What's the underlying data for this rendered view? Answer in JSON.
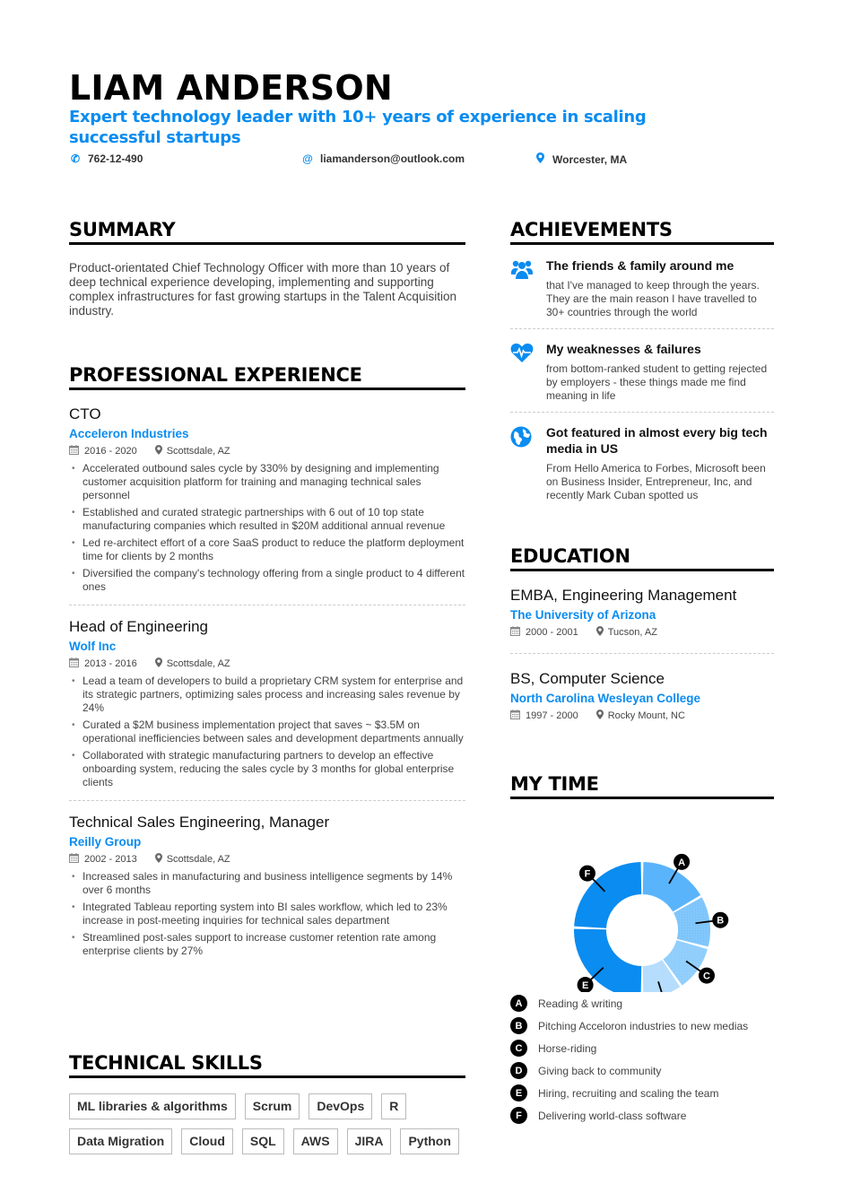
{
  "header": {
    "name": "LIAM ANDERSON",
    "tagline": "Expert technology leader with 10+ years of experience in scaling successful startups",
    "phone": "762-12-490",
    "email": "liamanderson@outlook.com",
    "location": "Worcester, MA",
    "icons": {
      "phone": "phone-icon",
      "email": "at-icon",
      "location": "map-pin-icon"
    }
  },
  "summary": {
    "title": "SUMMARY",
    "text": "Product-orientated Chief Technology Officer with more than 10 years of deep technical experience developing, implementing and supporting complex infrastructures for fast growing startups in the Talent Acquisition industry."
  },
  "experience": {
    "title": "PROFESSIONAL EXPERIENCE",
    "jobs": [
      {
        "title": "CTO",
        "company": "Acceleron Industries",
        "dates": "2016 - 2020",
        "location": "Scottsdale, AZ",
        "bullets": [
          "Accelerated outbound sales cycle by 330% by designing and implementing customer acquisition platform for training and managing technical sales personnel",
          "Established and curated strategic partnerships with 6 out of 10 top state manufacturing companies which resulted in $20M additional annual revenue",
          "Led re-architect effort of a core SaaS product to reduce the platform deployment time for clients by 2 months",
          "Diversified the company's technology offering from a single product to 4 different ones"
        ]
      },
      {
        "title": "Head of Engineering",
        "company": "Wolf Inc",
        "dates": "2013 - 2016",
        "location": "Scottsdale, AZ",
        "bullets": [
          "Lead a team of developers to build a proprietary CRM system for enterprise and its strategic partners, optimizing sales process and increasing sales revenue by 24%",
          "Curated a $2M business implementation project that saves ~ $3.5M on operational inefficiencies between sales and development departments annually",
          "Collaborated with strategic manufacturing partners to develop an effective onboarding system, reducing the sales cycle by 3 months for global enterprise clients"
        ]
      },
      {
        "title": "Technical Sales Engineering, Manager",
        "company": "Reilly Group",
        "dates": "2002 - 2013",
        "location": "Scottsdale, AZ",
        "bullets": [
          "Increased sales in manufacturing and business intelligence segments by 14% over 6 months",
          "Integrated Tableau reporting system into BI sales workflow, which led to 23% increase in post-meeting inquiries for technical sales department",
          "Streamlined post-sales support to increase customer retention rate among enterprise clients by 27%"
        ]
      }
    ]
  },
  "skills": {
    "title": "TECHNICAL SKILLS",
    "items": [
      "ML libraries & algorithms",
      "Scrum",
      "DevOps",
      "R",
      "Data Migration",
      "Cloud",
      "SQL",
      "AWS",
      "JIRA",
      "Python"
    ]
  },
  "achievements": {
    "title": "ACHIEVEMENTS",
    "items": [
      {
        "icon": "users-icon",
        "title": "The friends & family around me",
        "desc": "that I've managed to keep through the years. They are the main reason I have travelled to 30+ countries through the world"
      },
      {
        "icon": "heartbeat-icon",
        "title": "My weaknesses & failures",
        "desc": "from bottom-ranked student to getting rejected by employers - these things made me find meaning in life"
      },
      {
        "icon": "globe-icon",
        "title": "Got featured in almost every big tech media in US",
        "desc": "From Hello America to Forbes, Microsoft been on Business Insider, Entrepreneur, Inc, and recently Mark Cuban spotted us"
      }
    ]
  },
  "education": {
    "title": "EDUCATION",
    "items": [
      {
        "degree": "EMBA, Engineering Management",
        "school": "The University of Arizona",
        "dates": "2000 - 2001",
        "location": "Tucson, AZ"
      },
      {
        "degree": "BS, Computer Science",
        "school": "North Carolina Wesleyan College",
        "dates": "1997 - 2000",
        "location": "Rocky Mount, NC"
      }
    ]
  },
  "my_time": {
    "title": "MY TIME"
  },
  "colors": {
    "accent": "#0a8cf0",
    "text": "#1a1a1a"
  },
  "chart_data": {
    "type": "pie",
    "title": "MY TIME",
    "donut": true,
    "legend_position": "bottom",
    "categories": [
      "A",
      "B",
      "C",
      "D",
      "E",
      "F"
    ],
    "labels": [
      "Reading & writing",
      "Pitching Acceloron industries to new medias",
      "Horse-riding",
      "Giving back to community",
      "Hiring, recruiting and scaling the team",
      "Delivering world-class software"
    ],
    "values": [
      16.7,
      12.5,
      11.1,
      9.7,
      25.6,
      24.4
    ],
    "colors": [
      "#5ab4fb",
      "#7cc4fb",
      "#8ecdfc",
      "#b3dcfd",
      "#0a8cf0",
      "#0a8cf0"
    ]
  }
}
